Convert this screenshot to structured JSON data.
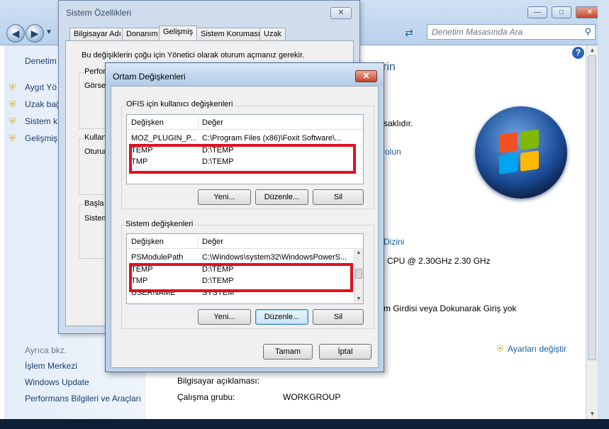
{
  "control_panel": {
    "search_placeholder": "Denetim Masasında Ara",
    "left_nav": {
      "home": "Denetim",
      "items": [
        "Aygıt Yö",
        "Uzak bağ",
        "Sistem k",
        "Gelişmiş"
      ],
      "see_also_header": "Ayrıca bkz.",
      "see_also": [
        "İşlem Merkezi",
        "Windows Update",
        "Performans Bilgileri ve Araçları"
      ]
    },
    "main": {
      "heading_fragment": "rin",
      "reserved_text": "saklıdır.",
      "link_olun": "olun",
      "index_link": "Dizini",
      "cpu": "CPU @ 2.30GHz   2.30 GHz",
      "pen_touch": "m Girdisi veya Dokunarak Giriş yok",
      "change_settings": "Ayarları değiştir",
      "computer_description_label": "Bilgisayar açıklaması:",
      "workgroup_label": "Çalışma grubu:",
      "workgroup_value": "WORKGROUP"
    }
  },
  "system_properties": {
    "title": "Sistem Özellikleri",
    "tabs": [
      "Bilgisayar Adı",
      "Donanım",
      "Gelişmiş",
      "Sistem Koruması",
      "Uzak"
    ],
    "active_tab": "Gelişmiş",
    "admin_notice": "Bu değişiklerin çoğu için Yönetici olarak oturum açmanız gerekir.",
    "groups": {
      "performance": "Perfor",
      "visual": "Görse",
      "user_profiles": "Kullan",
      "user_desc": "Oturun",
      "startup": "Başla",
      "system": "Sistem"
    }
  },
  "env_dialog": {
    "title": "Ortam Değişkenleri",
    "user_section_label": "OFIS için kullanıcı değişkenleri",
    "system_section_label": "Sistem değişkenleri",
    "col_variable": "Değişken",
    "col_value": "Değer",
    "user_vars": [
      {
        "name": "MOZ_PLUGIN_P...",
        "value": "C:\\Program Files (x86)\\Foxit Software\\..."
      },
      {
        "name": "TEMP",
        "value": "D:\\TEMP"
      },
      {
        "name": "TMP",
        "value": "D:\\TEMP"
      }
    ],
    "system_vars": [
      {
        "name": "PSModulePath",
        "value": "C:\\Windows\\system32\\WindowsPowerS..."
      },
      {
        "name": "TEMP",
        "value": "D:\\TEMP"
      },
      {
        "name": "TMP",
        "value": "D:\\TEMP"
      },
      {
        "name": "USERNAME",
        "value": "SYSTEM"
      }
    ],
    "buttons": {
      "new": "Yeni...",
      "edit": "Düzenle...",
      "delete": "Sil",
      "ok": "Tamam",
      "cancel": "İptal"
    },
    "highlight_color": "#e0101f"
  }
}
